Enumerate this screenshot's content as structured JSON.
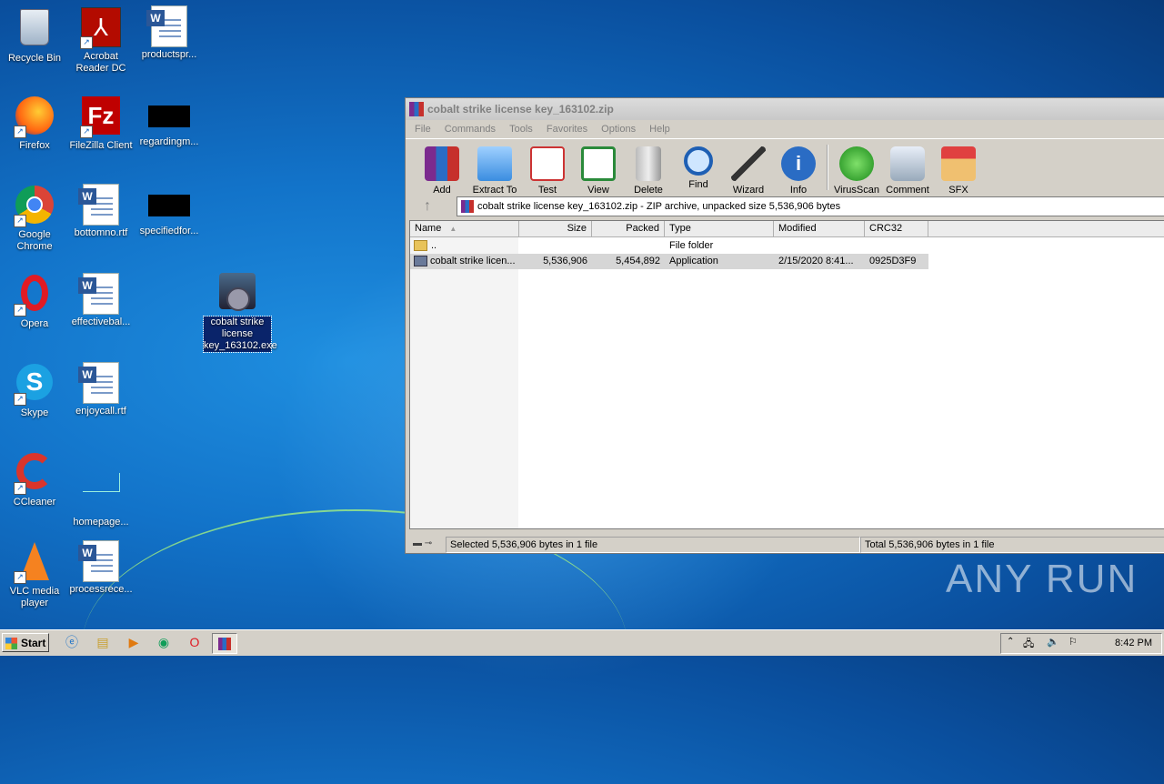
{
  "desktop": {
    "icons": [
      {
        "label": "Recycle Bin"
      },
      {
        "label": "Acrobat Reader DC"
      },
      {
        "label": "productspr..."
      },
      {
        "label": "Firefox"
      },
      {
        "label": "FileZilla Client"
      },
      {
        "label": "regardingm..."
      },
      {
        "label": "Google Chrome"
      },
      {
        "label": "bottomno.rtf"
      },
      {
        "label": "specifiedfor..."
      },
      {
        "label": "Opera"
      },
      {
        "label": "effectivebal..."
      },
      {
        "label": "cobalt strike license key_163102.exe"
      },
      {
        "label": "Skype"
      },
      {
        "label": "enjoycall.rtf"
      },
      {
        "label": "CCleaner"
      },
      {
        "label": "homepage..."
      },
      {
        "label": "VLC media player"
      },
      {
        "label": "processrece..."
      }
    ]
  },
  "window": {
    "title": "cobalt strike license key_163102.zip",
    "menu": [
      "File",
      "Commands",
      "Tools",
      "Favorites",
      "Options",
      "Help"
    ],
    "toolbar": [
      "Add",
      "Extract To",
      "Test",
      "View",
      "Delete",
      "Find",
      "Wizard",
      "Info",
      "VirusScan",
      "Comment",
      "SFX"
    ],
    "address": "cobalt strike license key_163102.zip - ZIP archive, unpacked size 5,536,906 bytes",
    "columns": [
      "Name",
      "Size",
      "Packed",
      "Type",
      "Modified",
      "CRC32"
    ],
    "rows": [
      {
        "name": "..",
        "size": "",
        "packed": "",
        "type": "File folder",
        "modified": "",
        "crc": ""
      },
      {
        "name": "cobalt strike licen...",
        "size": "5,536,906",
        "packed": "5,454,892",
        "type": "Application",
        "modified": "2/15/2020 8:41...",
        "crc": "0925D3F9"
      }
    ],
    "status_left": "Selected 5,536,906 bytes in 1 file",
    "status_right": "Total 5,536,906 bytes in 1 file"
  },
  "watermark": "ANY RUN",
  "taskbar": {
    "start": "Start",
    "clock": "8:42 PM"
  }
}
